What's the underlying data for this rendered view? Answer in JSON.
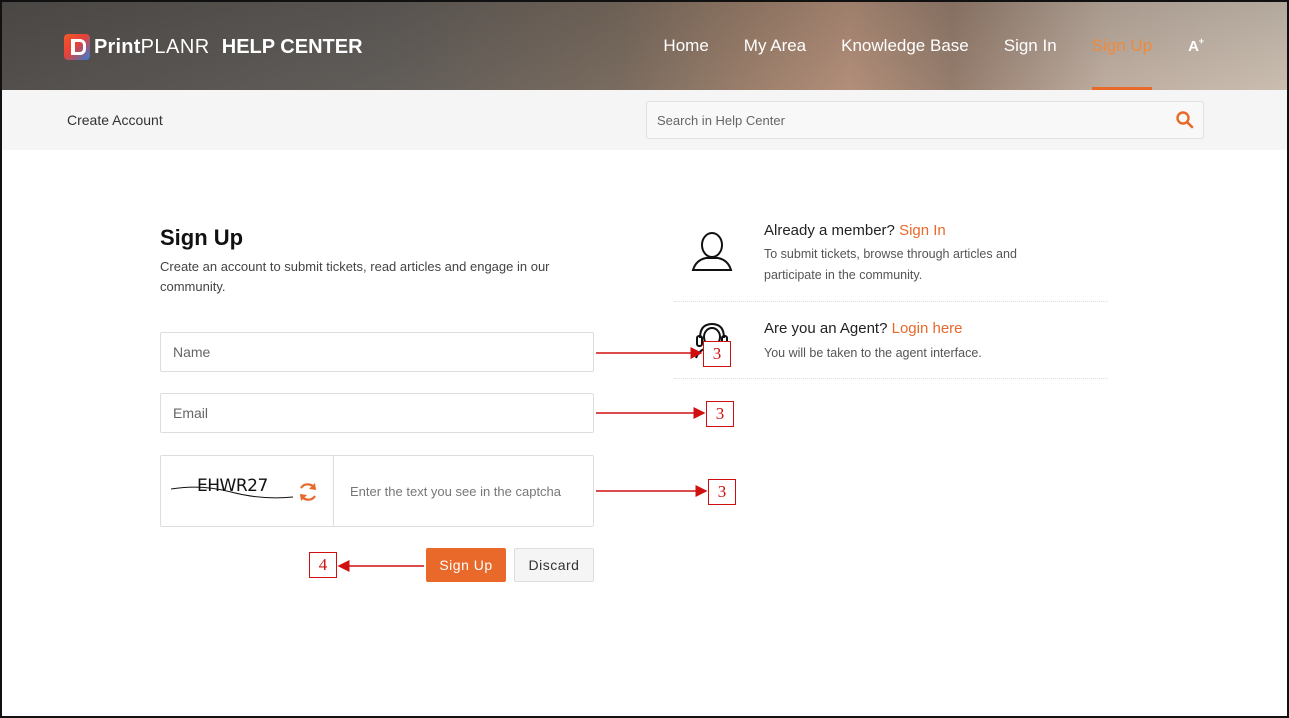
{
  "header": {
    "logo": {
      "brand_bold": "Print",
      "brand_light": "PLANR",
      "suffix": "HELP CENTER"
    },
    "nav": [
      {
        "label": "Home",
        "active": false
      },
      {
        "label": "My Area",
        "active": false
      },
      {
        "label": "Knowledge Base",
        "active": false
      },
      {
        "label": "Sign In",
        "active": false
      },
      {
        "label": "Sign Up",
        "active": true
      }
    ],
    "a11y_label": "A",
    "active_color": "#e8692a"
  },
  "subbar": {
    "breadcrumb": "Create Account",
    "search_placeholder": "Search in Help Center"
  },
  "form": {
    "title": "Sign Up",
    "description": "Create an account to submit tickets, read articles and engage in our community.",
    "name_placeholder": "Name",
    "email_placeholder": "Email",
    "captcha_text": "EHWR27",
    "captcha_placeholder": "Enter the text you see in the captcha",
    "submit_label": "Sign Up",
    "discard_label": "Discard"
  },
  "panel": {
    "member": {
      "question": "Already a member?",
      "link": "Sign In",
      "text": "To submit tickets, browse through articles and participate in the community."
    },
    "agent": {
      "question": "Are you an Agent?",
      "link": "Login here",
      "text": "You will be taken to the agent interface."
    }
  },
  "annotations": [
    "3",
    "3",
    "3",
    "4"
  ],
  "colors": {
    "accent": "#e8692a",
    "annotation": "#d01010"
  }
}
